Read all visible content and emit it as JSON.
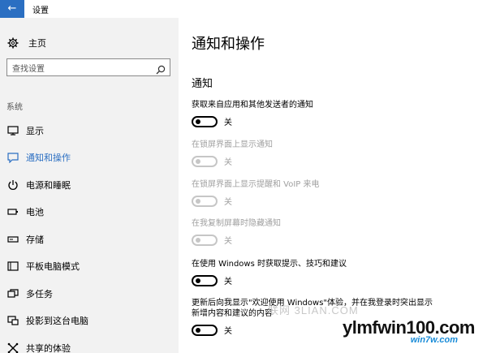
{
  "window": {
    "title": "设置",
    "back_icon": "arrow-left-icon",
    "accent_color": "#2b6fc2"
  },
  "sidebar": {
    "home_label": "主页",
    "home_icon": "gear-icon",
    "search_placeholder": "查找设置",
    "section_label": "系统",
    "items": [
      {
        "label": "显示",
        "icon": "monitor-icon",
        "active": false
      },
      {
        "label": "通知和操作",
        "icon": "message-icon",
        "active": true
      },
      {
        "label": "电源和睡眠",
        "icon": "power-icon",
        "active": false
      },
      {
        "label": "电池",
        "icon": "battery-icon",
        "active": false
      },
      {
        "label": "存储",
        "icon": "storage-icon",
        "active": false
      },
      {
        "label": "平板电脑模式",
        "icon": "tablet-icon",
        "active": false
      },
      {
        "label": "多任务",
        "icon": "multitask-icon",
        "active": false
      },
      {
        "label": "投影到这台电脑",
        "icon": "project-icon",
        "active": false
      },
      {
        "label": "共享的体验",
        "icon": "share-icon",
        "active": false
      }
    ]
  },
  "main": {
    "title": "通知和操作",
    "section_title": "通知",
    "settings": [
      {
        "label": "获取来自应用和其他发送者的通知",
        "state": "关",
        "enabled": true
      },
      {
        "label": "在锁屏界面上显示通知",
        "state": "关",
        "enabled": false
      },
      {
        "label": "在锁屏界面上显示提醒和 VoIP 来电",
        "state": "关",
        "enabled": false
      },
      {
        "label": "在我复制屏幕时隐藏通知",
        "state": "关",
        "enabled": false
      },
      {
        "label": "在使用 Windows 时获取提示、技巧和建议",
        "state": "关",
        "enabled": true
      },
      {
        "label": "更新后向我显示\"欢迎使用 Windows\"体验，并在我登录时突出显示新增内容和建议的内容",
        "state": "关",
        "enabled": true
      }
    ]
  },
  "watermark": {
    "text": "联网 3LIAN.COM",
    "brand": "ylmfwin100.com",
    "brand_sub": "win7w.com"
  }
}
